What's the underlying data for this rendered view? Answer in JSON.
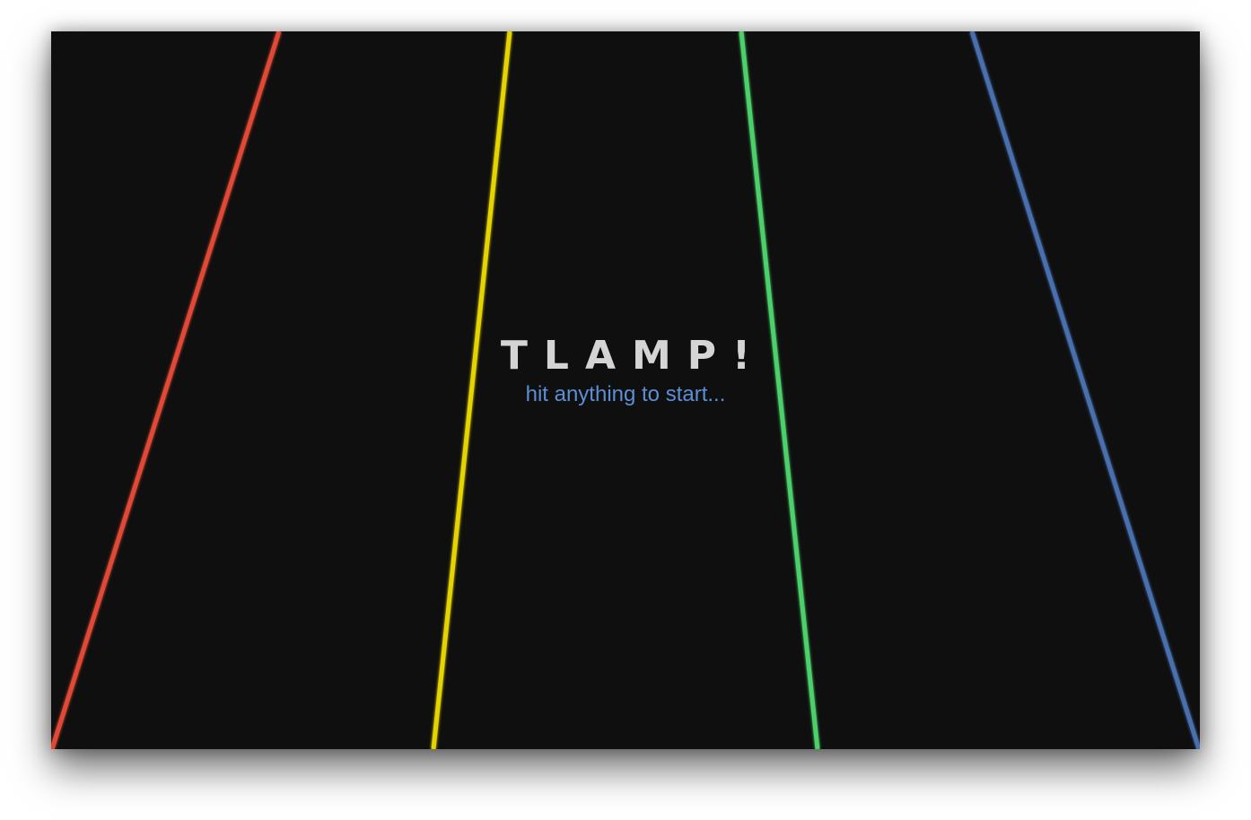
{
  "title": "TLAMP!",
  "subtitle": "hit anything to start...",
  "lanes": [
    {
      "name": "red-lane",
      "color": "#e04a35"
    },
    {
      "name": "yellow-lane",
      "color": "#e5d400"
    },
    {
      "name": "green-lane",
      "color": "#4cd06a"
    },
    {
      "name": "blue-lane",
      "color": "#4a6fae"
    }
  ],
  "hit_line": {
    "color": "#e08a00"
  },
  "background": "#0f0f0f"
}
